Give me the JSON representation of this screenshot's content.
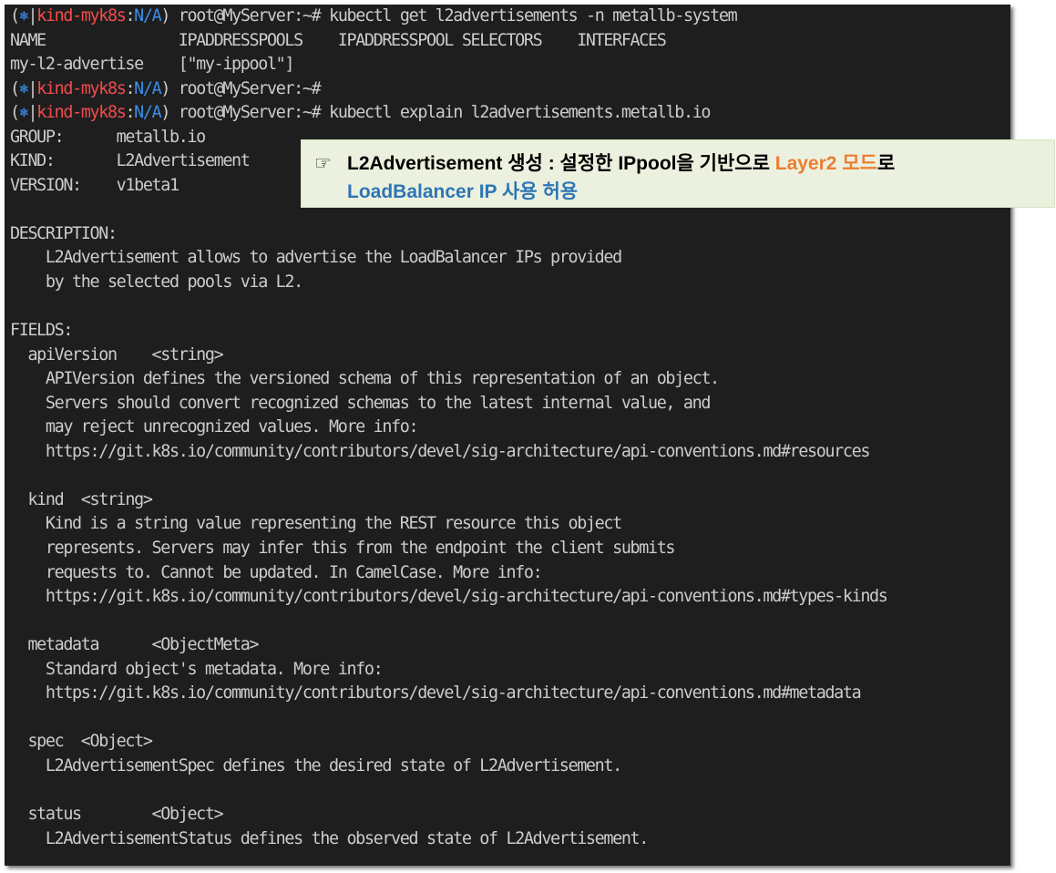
{
  "prompt": {
    "icon": "kubernetes-icon",
    "icon_glyph": "⎈",
    "cluster": "kind-myk8s",
    "namespace": "N/A",
    "host": "root@MyServer:~#"
  },
  "terminal": {
    "lines": [
      {
        "type": "prompt",
        "cmd": "kubectl get l2advertisements -n metallb-system"
      },
      {
        "type": "text",
        "text": "NAME               IPADDRESSPOOLS    IPADDRESSPOOL SELECTORS    INTERFACES"
      },
      {
        "type": "text",
        "text": "my-l2-advertise    [\"my-ippool\"]"
      },
      {
        "type": "prompt",
        "cmd": ""
      },
      {
        "type": "prompt",
        "cmd": "kubectl explain l2advertisements.metallb.io"
      },
      {
        "type": "text",
        "text": "GROUP:      metallb.io"
      },
      {
        "type": "text",
        "text": "KIND:       L2Advertisement"
      },
      {
        "type": "text",
        "text": "VERSION:    v1beta1"
      },
      {
        "type": "text",
        "text": ""
      },
      {
        "type": "text",
        "text": "DESCRIPTION:"
      },
      {
        "type": "text",
        "text": "    L2Advertisement allows to advertise the LoadBalancer IPs provided"
      },
      {
        "type": "text",
        "text": "    by the selected pools via L2."
      },
      {
        "type": "text",
        "text": ""
      },
      {
        "type": "text",
        "text": "FIELDS:"
      },
      {
        "type": "text",
        "text": "  apiVersion    <string>"
      },
      {
        "type": "text",
        "text": "    APIVersion defines the versioned schema of this representation of an object."
      },
      {
        "type": "text",
        "text": "    Servers should convert recognized schemas to the latest internal value, and"
      },
      {
        "type": "text",
        "text": "    may reject unrecognized values. More info:"
      },
      {
        "type": "text",
        "text": "    https://git.k8s.io/community/contributors/devel/sig-architecture/api-conventions.md#resources"
      },
      {
        "type": "text",
        "text": ""
      },
      {
        "type": "text",
        "text": "  kind  <string>"
      },
      {
        "type": "text",
        "text": "    Kind is a string value representing the REST resource this object"
      },
      {
        "type": "text",
        "text": "    represents. Servers may infer this from the endpoint the client submits"
      },
      {
        "type": "text",
        "text": "    requests to. Cannot be updated. In CamelCase. More info:"
      },
      {
        "type": "text",
        "text": "    https://git.k8s.io/community/contributors/devel/sig-architecture/api-conventions.md#types-kinds"
      },
      {
        "type": "text",
        "text": ""
      },
      {
        "type": "text",
        "text": "  metadata      <ObjectMeta>"
      },
      {
        "type": "text",
        "text": "    Standard object's metadata. More info:"
      },
      {
        "type": "text",
        "text": "    https://git.k8s.io/community/contributors/devel/sig-architecture/api-conventions.md#metadata"
      },
      {
        "type": "text",
        "text": ""
      },
      {
        "type": "text",
        "text": "  spec  <Object>"
      },
      {
        "type": "text",
        "text": "    L2AdvertisementSpec defines the desired state of L2Advertisement."
      },
      {
        "type": "text",
        "text": ""
      },
      {
        "type": "text",
        "text": "  status        <Object>"
      },
      {
        "type": "text",
        "text": "    L2AdvertisementStatus defines the observed state of L2Advertisement."
      }
    ]
  },
  "callout": {
    "icon": "pointing-hand-icon",
    "icon_glyph": "☞",
    "text_part1": "L2Advertisement 생성 : 설정한 IPpool을 기반으로 ",
    "text_orange": "Layer2 모드",
    "text_part2": "로",
    "text_blue": "LoadBalancer IP 사용 허용"
  },
  "colors": {
    "background": "#1e1e1e",
    "text": "#cccccc",
    "cluster": "#f14c4c",
    "namespace": "#3b8eea",
    "callout_bg": "#ebf1de",
    "callout_orange": "#ed7d31",
    "callout_blue": "#2e75b6"
  }
}
